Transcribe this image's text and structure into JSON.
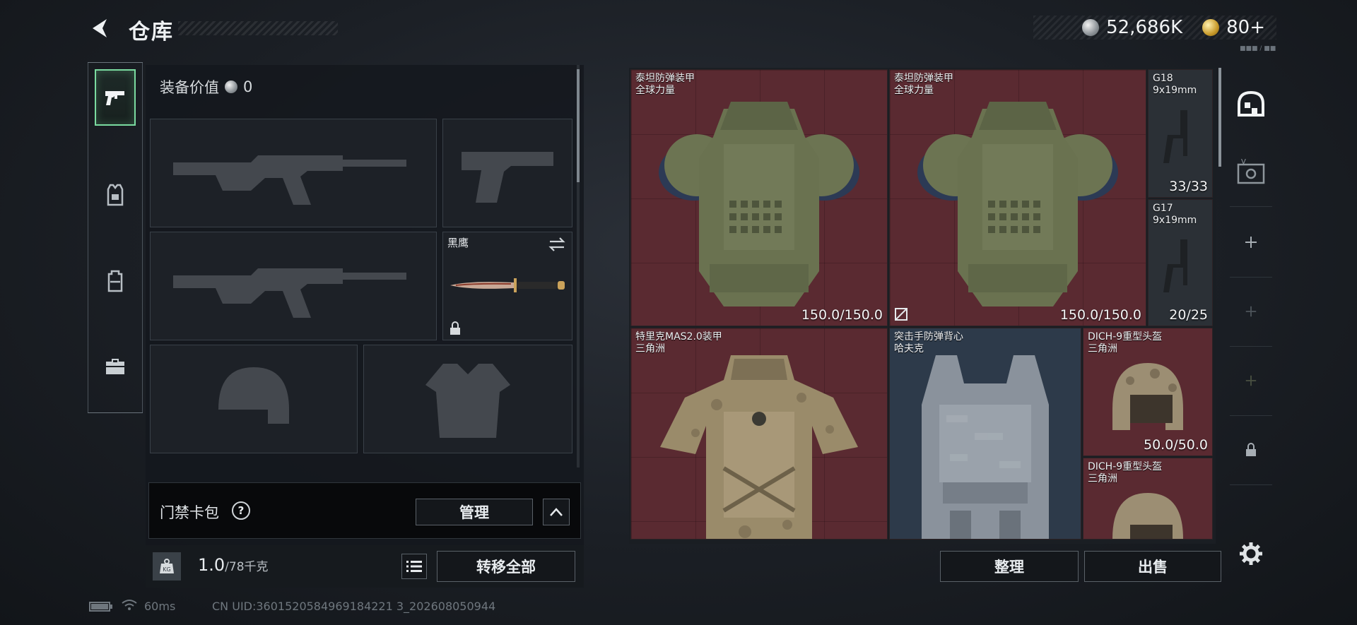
{
  "header": {
    "title": "仓库",
    "currency": [
      {
        "icon": "silver-coin-icon",
        "value": "52,686K"
      },
      {
        "icon": "gold-coin-icon",
        "value": "80+"
      }
    ],
    "tiny_label": "■■■ / ■■"
  },
  "rail": {
    "items": [
      {
        "name": "weapons",
        "icon": "pistol-icon",
        "active": true
      },
      {
        "name": "armor",
        "icon": "vest-icon",
        "active": false
      },
      {
        "name": "backpack",
        "icon": "backpack-icon",
        "active": false
      },
      {
        "name": "kit",
        "icon": "toolbox-icon",
        "active": false
      }
    ]
  },
  "equipment": {
    "value_label": "装备价值",
    "value": "0",
    "knife_slot_name": "黑鹰"
  },
  "card_pack": {
    "label": "门禁卡包",
    "help": "?",
    "manage": "管理"
  },
  "weight": {
    "current": "1.0",
    "capacity": "/78千克"
  },
  "buttons": {
    "transfer_all": "转移全部",
    "sort": "整理",
    "sell": "出售"
  },
  "stash": {
    "items": [
      {
        "name": "泰坦防弹装甲",
        "origin": "全球力量",
        "durability": "150.0/150.0",
        "color": "#5a2a31"
      },
      {
        "name": "泰坦防弹装甲",
        "origin": "全球力量",
        "durability": "150.0/150.0",
        "color": "#5a2a31"
      },
      {
        "name": "G18",
        "origin": "9x19mm",
        "durability": "33/33",
        "color": "#2b3036"
      },
      {
        "name": "G17",
        "origin": "9x19mm",
        "durability": "20/25",
        "color": "#2b3036"
      },
      {
        "name": "特里克MAS2.0装甲",
        "origin": "三角洲",
        "durability": "",
        "color": "#5a2a31"
      },
      {
        "name": "突击手防弹背心",
        "origin": "哈夫克",
        "durability": "",
        "color": "#2d3a4a"
      },
      {
        "name": "DICH-9重型头盔",
        "origin": "三角洲",
        "durability": "50.0/50.0",
        "color": "#5a2a31"
      },
      {
        "name": "DICH-9重型头盔",
        "origin": "三角洲",
        "durability": "",
        "color": "#5a2a31"
      }
    ]
  },
  "status": {
    "latency": "60ms",
    "uid": "CN UID:3601520584969184221 3_202608050944"
  }
}
